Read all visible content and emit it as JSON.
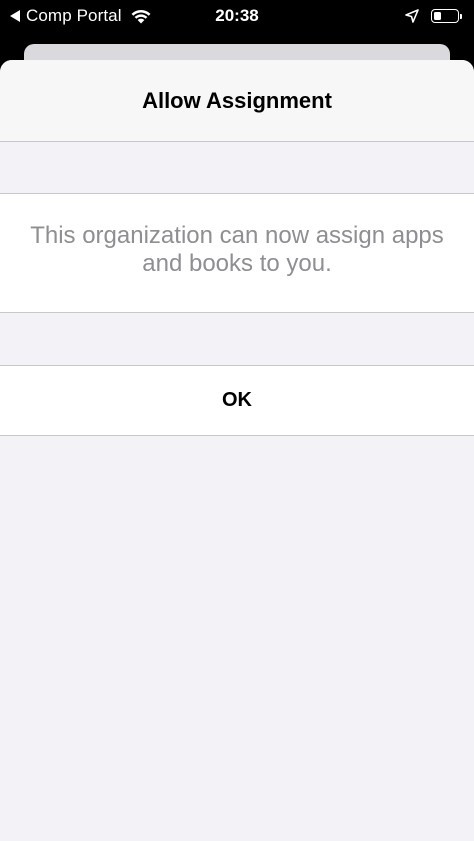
{
  "status_bar": {
    "back_app": "Comp Portal",
    "time": "20:38",
    "icons": [
      "back-triangle-icon",
      "wifi-icon",
      "location-arrow-icon",
      "battery-icon"
    ],
    "battery_level": 0.35
  },
  "sheet": {
    "title": "Allow Assignment",
    "message": "This organization can now assign apps and books to you.",
    "ok_label": "OK"
  },
  "colors": {
    "background": "#000000",
    "sheet_background": "#f2f2f7",
    "section_background": "#ffffff",
    "message_text": "#8e8e93",
    "separator": "#c8c7cc"
  }
}
